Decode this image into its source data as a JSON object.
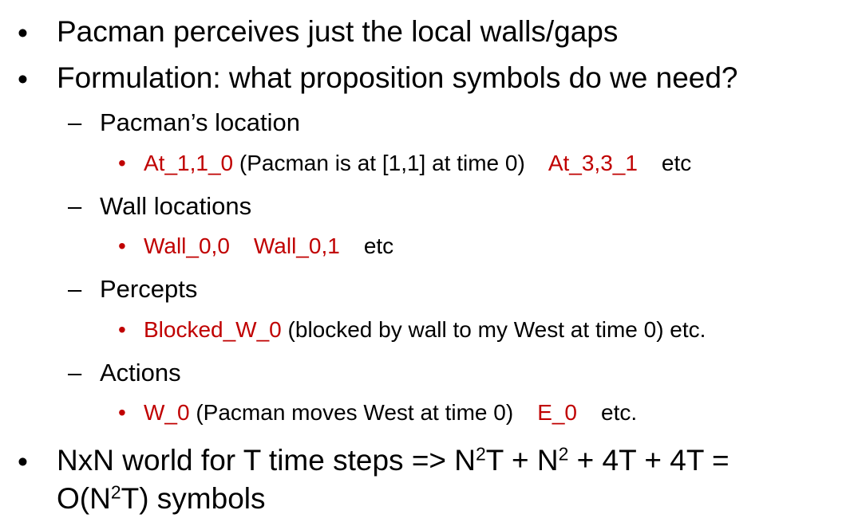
{
  "bullets": {
    "level1": "•",
    "level2": "–",
    "level3": "•"
  },
  "items": [
    {
      "text": "Pacman perceives just the local walls/gaps"
    },
    {
      "text": "Formulation: what proposition symbols do we need?"
    },
    {
      "text": "Pacman’s location"
    },
    {
      "a": "At_1,1_0",
      "b": " (Pacman is at [1,1] at time 0)",
      "c": "At_3,3_1",
      "d": "etc"
    },
    {
      "text": "Wall locations"
    },
    {
      "a": "Wall_0,0",
      "b": "Wall_0,1",
      "c": "etc"
    },
    {
      "text": "Percepts"
    },
    {
      "a": "Blocked_W_0",
      "b": " (blocked by wall to my West at time 0) etc."
    },
    {
      "text": "Actions"
    },
    {
      "a": "W_0",
      "b": " (Pacman moves West at time 0)",
      "c": "E_0",
      "d": "etc."
    },
    {
      "p1": "NxN world for T time steps => N",
      "sup1": "2",
      "p2": "T + N",
      "sup2": "2",
      "p3": " + 4T + 4T =",
      "p4": "O(N",
      "sup3": "2",
      "p5": "T) symbols"
    }
  ],
  "colors": {
    "text": "#000000",
    "highlight": "#c00000"
  }
}
